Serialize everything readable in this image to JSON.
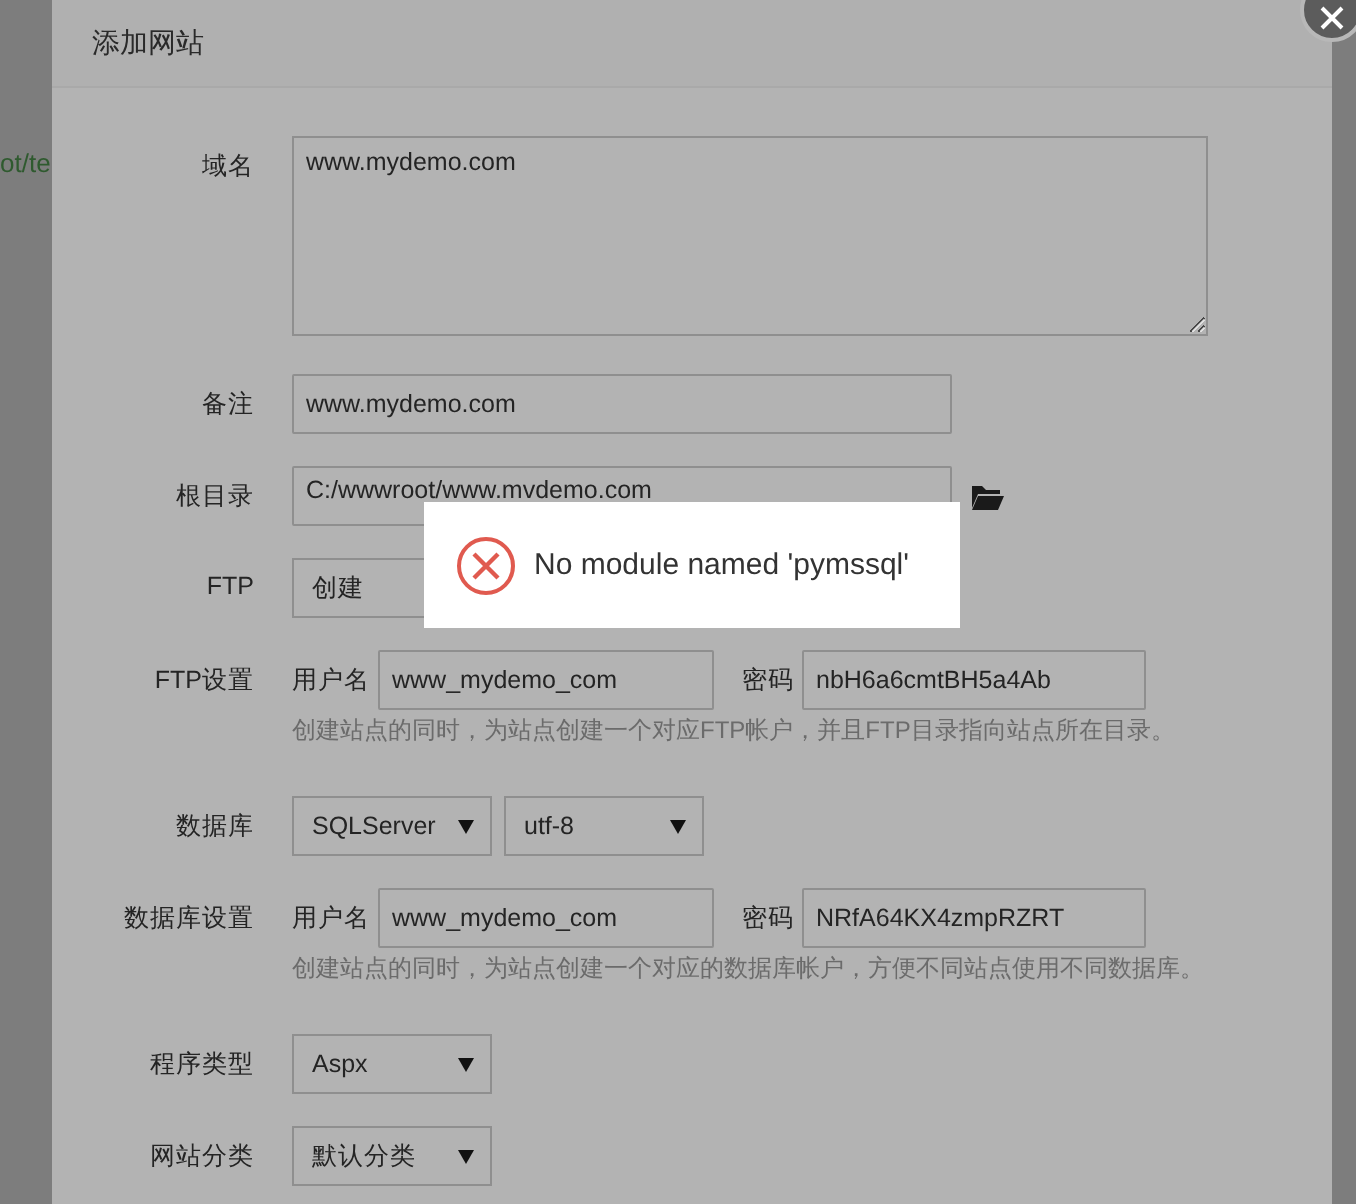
{
  "background": {
    "path_fragment": "ot/te"
  },
  "dialog": {
    "title": "添加网站",
    "fields": [
      {
        "kind": "textarea",
        "label": "域名",
        "value": "www.mydemo.com"
      },
      {
        "kind": "input",
        "label": "备注",
        "value": "www.mydemo.com"
      },
      {
        "kind": "path",
        "label": "根目录",
        "value": "C:/wwwroot/www.mvdemo.com"
      },
      {
        "kind": "select_under_toast",
        "label": "FTP",
        "options": [
          "创建"
        ]
      },
      {
        "kind": "account",
        "label": "FTP设置",
        "username_label": "用户名",
        "username": "www_mydemo_com",
        "password_label": "密码",
        "password": "nbH6a6cmtBH5a4Ab",
        "hint": "创建站点的同时，为站点创建一个对应FTP帐户，并且FTP目录指向站点所在目录。"
      },
      {
        "kind": "select",
        "label": "数据库",
        "options": [
          "SQLServer",
          "utf-8"
        ]
      },
      {
        "kind": "account",
        "label": "数据库设置",
        "username_label": "用户名",
        "username": "www_mydemo_com",
        "password_label": "密码",
        "password": "NRfA64KX4zmpRZRT",
        "hint": "创建站点的同时，为站点创建一个对应的数据库帐户，方便不同站点使用不同数据库。"
      },
      {
        "kind": "select",
        "label": "程序类型",
        "options": [
          "Aspx"
        ]
      },
      {
        "kind": "select",
        "label": "网站分类",
        "options": [
          "默认分类"
        ]
      }
    ]
  },
  "toast": {
    "kind": "error",
    "message": "No module named 'pymssql'"
  }
}
